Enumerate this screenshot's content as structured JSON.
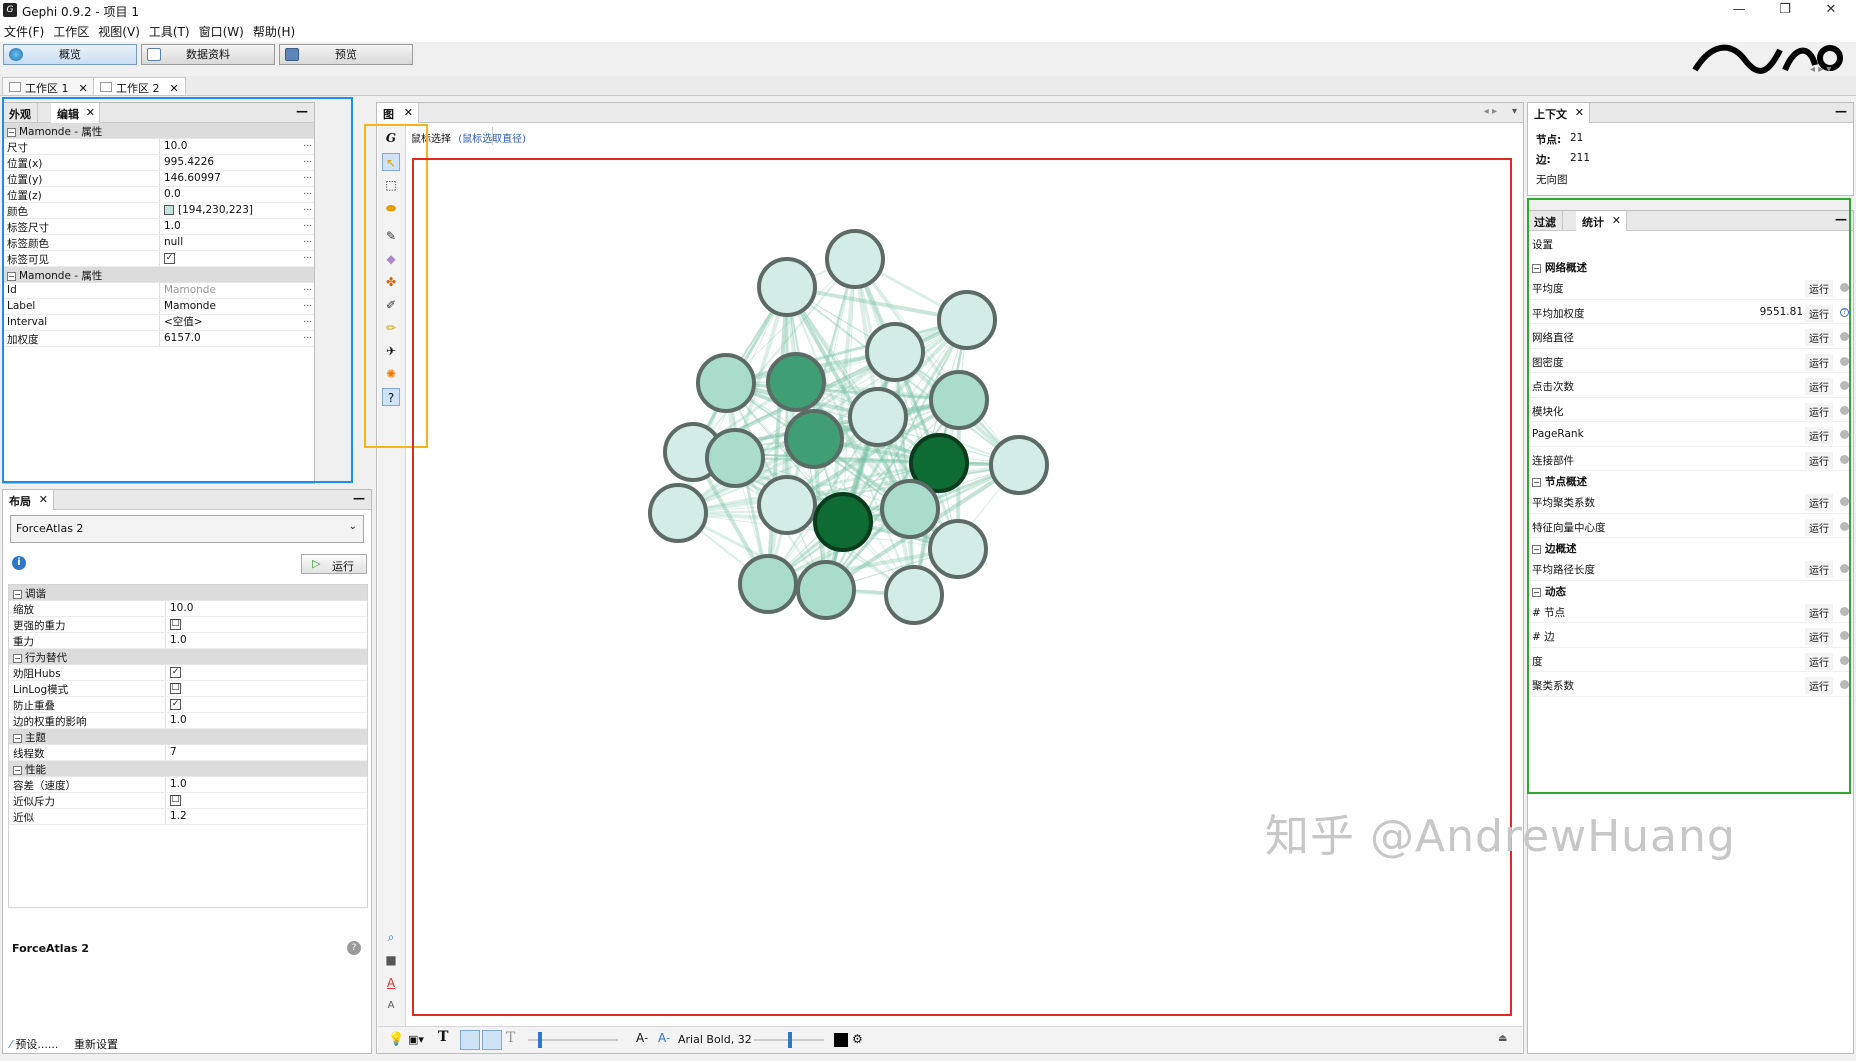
{
  "window": {
    "title": "Gephi 0.9.2 - 项目 1",
    "app_icon": "gephi-logo-icon",
    "minimize": "—",
    "maximize": "❐",
    "close": "✕"
  },
  "menu": [
    "文件(F)",
    "工作区",
    "视图(V)",
    "工具(T)",
    "窗口(W)",
    "帮助(H)"
  ],
  "main_tabs": [
    {
      "label": "概览",
      "icon": "globe-icon"
    },
    {
      "label": "数据资料",
      "icon": "table-icon"
    },
    {
      "label": "预览",
      "icon": "monitor-icon"
    }
  ],
  "workspace_tabs": [
    {
      "label": "工作区 1"
    },
    {
      "label": "工作区 2"
    }
  ],
  "editor": {
    "tabs": [
      "外观",
      "编辑"
    ],
    "section1": "Mamonde - 属性",
    "props1": [
      {
        "k": "尺寸",
        "v": "10.0"
      },
      {
        "k": "位置(x)",
        "v": "995.4226"
      },
      {
        "k": "位置(y)",
        "v": "146.60997"
      },
      {
        "k": "位置(z)",
        "v": "0.0"
      },
      {
        "k": "颜色",
        "v": "[194,230,223]",
        "color": "#c2e6df"
      },
      {
        "k": "标签尺寸",
        "v": "1.0"
      },
      {
        "k": "标签颜色",
        "v": "null"
      },
      {
        "k": "标签可见",
        "v": "✓"
      }
    ],
    "section2": "Mamonde - 属性",
    "props2": [
      {
        "k": "Id",
        "v": "Mamonde"
      },
      {
        "k": "Label",
        "v": "Mamonde"
      },
      {
        "k": "Interval",
        "v": "<空值>"
      },
      {
        "k": "加权度",
        "v": "6157.0"
      }
    ]
  },
  "layout": {
    "tab": "布局",
    "algorithm": "ForceAtlas 2",
    "run_label": "运行",
    "sections": [
      {
        "title": "调谐",
        "rows": [
          {
            "k": "缩放",
            "v": "10.0"
          },
          {
            "k": "更强的重力",
            "v": "☐"
          },
          {
            "k": "重力",
            "v": "1.0"
          }
        ]
      },
      {
        "title": "行为替代",
        "rows": [
          {
            "k": "劝阻Hubs",
            "v": "✓"
          },
          {
            "k": "LinLog模式",
            "v": "☐"
          },
          {
            "k": "防止重叠",
            "v": "✓"
          },
          {
            "k": "边的权重的影响",
            "v": "1.0"
          }
        ]
      },
      {
        "title": "主题",
        "rows": [
          {
            "k": "线程数",
            "v": "7"
          }
        ]
      },
      {
        "title": "性能",
        "rows": [
          {
            "k": "容差（速度）",
            "v": "1.0"
          },
          {
            "k": "近似斥力",
            "v": "☐"
          },
          {
            "k": "近似",
            "v": "1.2"
          }
        ]
      }
    ],
    "desc_title": "ForceAtlas 2",
    "preset_label": "预设......",
    "reset_label": "重新设置"
  },
  "graph": {
    "tab": "图",
    "mouse_select": "鼠标选择",
    "mouse_select_hint": "(鼠标选取直径)",
    "font_label": "Arial Bold, 32",
    "tools": [
      "pointer-icon",
      "rect-select-icon",
      "lasso-icon",
      "brush-icon",
      "diamond-icon",
      "painter-icon",
      "pencil-icon",
      "edge-pencil-icon",
      "plane-icon",
      "gear-node-icon",
      "hint-icon"
    ]
  },
  "context": {
    "tab": "上下文",
    "nodes_label": "节点:",
    "nodes": "21",
    "edges_label": "边:",
    "edges": "211",
    "graph_type": "无向图"
  },
  "stats": {
    "tabs": [
      "过滤",
      "统计"
    ],
    "settings": "设置",
    "run_label": "运行",
    "groups": [
      {
        "title": "网络概述",
        "items": [
          {
            "n": "平均度"
          },
          {
            "n": "平均加权度",
            "val": "9551.81",
            "info": true
          },
          {
            "n": "网络直径"
          },
          {
            "n": "图密度"
          },
          {
            "n": "点击次数"
          },
          {
            "n": "模块化"
          },
          {
            "n": "PageRank"
          },
          {
            "n": "连接部件"
          }
        ]
      },
      {
        "title": "节点概述",
        "items": [
          {
            "n": "平均聚类系数"
          },
          {
            "n": "特征向量中心度"
          }
        ]
      },
      {
        "title": "边概述",
        "items": [
          {
            "n": "平均路径长度"
          }
        ]
      },
      {
        "title": "动态",
        "items": [
          {
            "n": "# 节点"
          },
          {
            "n": "# 边"
          },
          {
            "n": "度"
          },
          {
            "n": "聚类系数"
          }
        ]
      }
    ]
  },
  "watermark": "知乎 @AndrewHuang",
  "colors": {
    "node_light": "#d4ece7",
    "node_mid": "#a9dccb",
    "node_dark": "#3f9e74",
    "node_darkest": "#0d6b33",
    "edge": "#7cc3a8"
  }
}
